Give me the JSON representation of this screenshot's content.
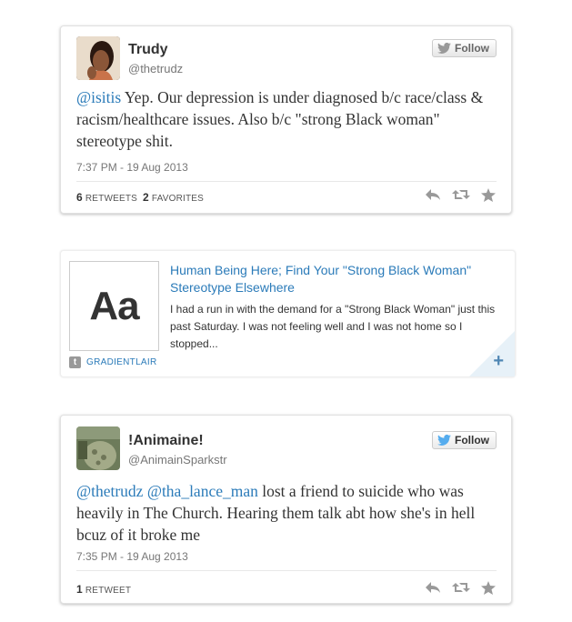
{
  "tweet1": {
    "name": "Trudy",
    "handle": "@thetrudz",
    "follow_label": "Follow",
    "text_mention": "@isitis",
    "text_body": " Yep. Our depression is under diagnosed b/c race/class & racism/healthcare issues. Also b/c \"strong Black woman\" stereotype shit.",
    "timestamp": "7:37 PM - 19 Aug 2013",
    "retweets_count": "6",
    "retweets_label": "RETWEETS",
    "favorites_count": "2",
    "favorites_label": "FAVORITES"
  },
  "link_card": {
    "thumb_text": "Aa",
    "title": "Human Being Here; Find Your \"Strong Black Woman\" Stereotype Elsewhere",
    "excerpt": "I had a run in with the demand for a \"Strong Black Woman\" just this past Saturday. I was not feeling well and I was not home so I stopped...",
    "source_icon": "t",
    "source": "GRADIENTLAIR",
    "expand_icon": "+"
  },
  "tweet2": {
    "name": "!Animaine!",
    "handle": "@AnimainSparkstr",
    "follow_label": "Follow",
    "mention1": "@thetrudz",
    "mention2": "@tha_lance_man",
    "text_body": " lost a friend to suicide who was heavily in The Church. Hearing them talk abt how she's in hell bcuz of it broke me",
    "timestamp": "7:35 PM - 19 Aug 2013",
    "retweets_count": "1",
    "retweets_label": "RETWEET"
  },
  "colors": {
    "link": "#2b7bb9",
    "accent": "#55acee",
    "muted": "#999999"
  },
  "icons": [
    "twitter-bird-icon",
    "reply-icon",
    "retweet-icon",
    "favorite-star-icon",
    "tumblr-icon",
    "plus-icon"
  ]
}
